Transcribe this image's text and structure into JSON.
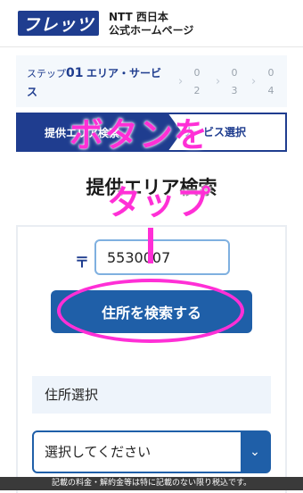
{
  "header": {
    "logo_text": "フレッツ",
    "brand_line1": "NTT 西日本",
    "brand_line2": "公式ホームページ"
  },
  "steps": {
    "step_label": "ステップ",
    "current_num": "01",
    "current_title_line1": "エリア・サービ",
    "current_title_line2": "ス",
    "others": [
      "0",
      "2",
      "0",
      "3",
      "0",
      "4"
    ]
  },
  "tabs": {
    "active_label": "提供エリア検索",
    "inactive_label": "サービス選択"
  },
  "page_title": "提供エリア検索",
  "form": {
    "postal_mark": "〒",
    "zip_value": "5530007",
    "search_button": "住所を検索する",
    "address_section_label": "住所選択",
    "select_placeholder": "選択してください"
  },
  "footer_note": "記載の料金・解約金等は特に記載のない限り税込です。",
  "annotation": {
    "line1": "ボタンを",
    "line2": "タップ"
  },
  "colors": {
    "brand": "#1f3d8f",
    "button": "#1f5fa8",
    "annotation": "#ff2fd6"
  }
}
